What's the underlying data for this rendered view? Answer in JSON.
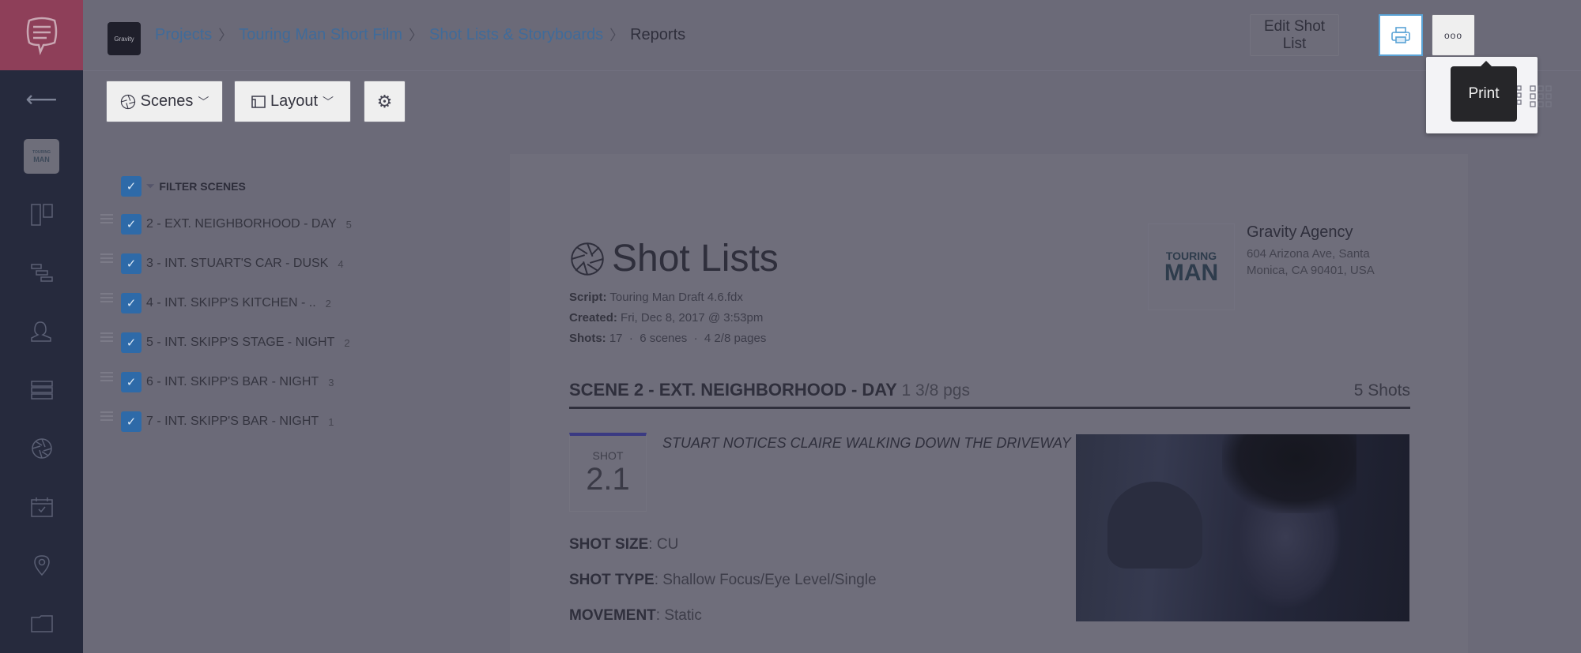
{
  "app": {
    "brand_label": "Gravity",
    "project_thumb": [
      "TOURING",
      "MAN"
    ]
  },
  "breadcrumb": [
    {
      "label": "Projects",
      "link": true
    },
    {
      "label": "Touring Man Short Film",
      "link": true
    },
    {
      "label": "Shot Lists & Storyboards",
      "link": true
    },
    {
      "label": "Reports",
      "link": false
    }
  ],
  "header": {
    "edit_label": "Edit Shot List",
    "print_tooltip": "Print",
    "more_label": "ooo"
  },
  "toolbar": {
    "scenes_label": "Scenes",
    "layout_label": "Layout"
  },
  "sidebar": {
    "icons": [
      "back-arrow-icon",
      "project-thumbnail",
      "board-icon",
      "stripboard-icon",
      "contacts-icon",
      "breakdown-list-icon",
      "shot-aperture-icon",
      "calendar-icon",
      "location-pin-icon",
      "folder-icon"
    ]
  },
  "filter": {
    "title": "FILTER SCENES",
    "scenes": [
      {
        "label": "2 - EXT. NEIGHBORHOOD - DAY",
        "count": "5",
        "checked": true
      },
      {
        "label": "3 - INT. STUART'S CAR - DUSK",
        "count": "4",
        "checked": true
      },
      {
        "label": "4 - INT. SKIPP'S KITCHEN - ..",
        "count": "2",
        "checked": true
      },
      {
        "label": "5 - INT. SKIPP'S STAGE - NIGHT",
        "count": "2",
        "checked": true
      },
      {
        "label": "6 - INT. SKIPP'S BAR - NIGHT",
        "count": "3",
        "checked": true
      },
      {
        "label": "7 - INT. SKIPP'S BAR - NIGHT",
        "count": "1",
        "checked": true
      }
    ]
  },
  "report": {
    "title": "Shot Lists",
    "script_label": "Script:",
    "script_value": "Touring Man Draft 4.6.fdx",
    "created_label": "Created:",
    "created_value": "Fri, Dec 8, 2017 @ 3:53pm",
    "shots_label": "Shots:",
    "shots_value": "17",
    "scenes_value": "6 scenes",
    "pages_value": "4 2/8 pages",
    "agency_logo": [
      "TOURING",
      "MAN"
    ],
    "agency_name": "Gravity Agency",
    "agency_address": "604 Arizona Ave, Santa Monica, CA 90401, USA"
  },
  "scene": {
    "heading": "SCENE 2 - EXT. NEIGHBORHOOD - DAY",
    "pages": "1 3/8 pgs",
    "shot_count": "5 Shots",
    "shot": {
      "label": "SHOT",
      "number": "2.1",
      "description": "STUART NOTICES CLAIRE WALKING DOWN THE DRIVEWAY",
      "size_label": "SHOT SIZE",
      "size_value": "CU",
      "type_label": "SHOT TYPE",
      "type_value": "Shallow Focus/Eye Level/Single",
      "movement_label": "MOVEMENT",
      "movement_value": "Static"
    }
  },
  "colors": {
    "accent_blue": "#5aa3d6",
    "checkbox_blue": "#2e6aa8",
    "logo_red": "#8e3f59",
    "rail_dark": "#262a3d"
  }
}
